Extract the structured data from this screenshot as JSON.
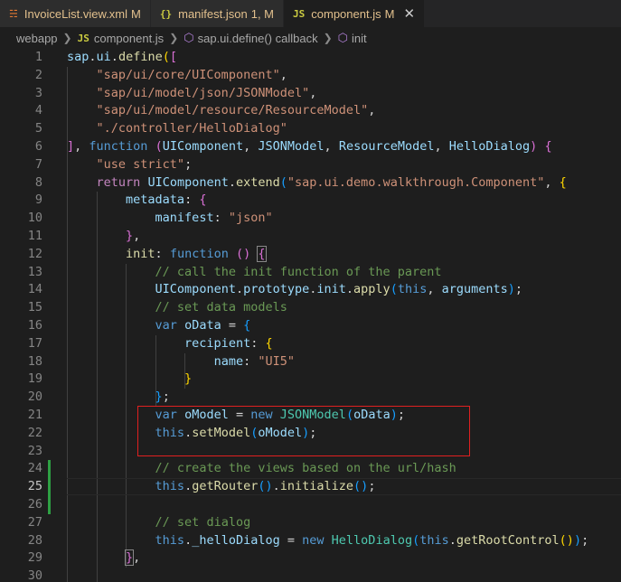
{
  "tabs": [
    {
      "icon": "rss-icon",
      "icon_text": "ॐ",
      "name": "InvoiceList.view.xml",
      "status": "M",
      "active": false
    },
    {
      "icon": "json-icon",
      "icon_text": "{}",
      "name": "manifest.json",
      "status": "1, M",
      "active": false
    },
    {
      "icon": "js-icon",
      "icon_text": "JS",
      "name": "component.js",
      "status": "M",
      "active": true
    }
  ],
  "breadcrumb": {
    "folder": "webapp",
    "file_icon": "JS",
    "file": "component.js",
    "symbol1": "sap.ui.define() callback",
    "symbol2": "init"
  },
  "editor": {
    "active_line": 25,
    "lines": [
      {
        "n": "1",
        "html": "<span class=\"v\">sap</span>.<span class=\"v\">ui</span>.<span class=\"f\">define</span><span class=\"y\">(</span><span class=\"p\">[</span>"
      },
      {
        "n": "2",
        "html": "    <span class=\"s\">\"sap/ui/core/UIComponent\"</span>,"
      },
      {
        "n": "3",
        "html": "    <span class=\"s\">\"sap/ui/model/json/JSONModel\"</span>,"
      },
      {
        "n": "4",
        "html": "    <span class=\"s\">\"sap/ui/model/resource/ResourceModel\"</span>,"
      },
      {
        "n": "5",
        "html": "    <span class=\"s\">\"./controller/HelloDialog\"</span>"
      },
      {
        "n": "6",
        "html": "<span class=\"p\">]</span>, <span class=\"k\">function</span> <span class=\"p\">(</span><span class=\"v\">UIComponent</span>, <span class=\"v\">JSONModel</span>, <span class=\"v\">ResourceModel</span>, <span class=\"v\">HelloDialog</span><span class=\"p\">)</span> <span class=\"p\">{</span>"
      },
      {
        "n": "7",
        "html": "    <span class=\"s\">\"use strict\"</span>;"
      },
      {
        "n": "8",
        "html": "    <span class=\"kc\">return</span> <span class=\"v\">UIComponent</span>.<span class=\"f\">extend</span><span class=\"b\">(</span><span class=\"s\">\"sap.ui.demo.walkthrough.Component\"</span>, <span class=\"y\">{</span>"
      },
      {
        "n": "9",
        "html": "        <span class=\"v\">metadata</span>: <span class=\"p\">{</span>"
      },
      {
        "n": "10",
        "html": "            <span class=\"v\">manifest</span>: <span class=\"s\">\"json\"</span>"
      },
      {
        "n": "11",
        "html": "        <span class=\"p\">}</span>,"
      },
      {
        "n": "12",
        "html": "        <span class=\"f\">init</span>: <span class=\"k\">function</span> <span class=\"p\">()</span> <span class=\"p bracket-box\">{</span>"
      },
      {
        "n": "13",
        "html": "            <span class=\"c\">// call the init function of the parent</span>"
      },
      {
        "n": "14",
        "html": "            <span class=\"v\">UIComponent</span>.<span class=\"v\">prototype</span>.<span class=\"v\">init</span>.<span class=\"f\">apply</span><span class=\"b\">(</span><span class=\"k\">this</span>, <span class=\"v\">arguments</span><span class=\"b\">)</span>;"
      },
      {
        "n": "15",
        "html": "            <span class=\"c\">// set data models</span>"
      },
      {
        "n": "16",
        "html": "            <span class=\"k\">var</span> <span class=\"v\">oData</span> = <span class=\"b\">{</span>"
      },
      {
        "n": "17",
        "html": "                <span class=\"v\">recipient</span>: <span class=\"y\">{</span>"
      },
      {
        "n": "18",
        "html": "                    <span class=\"v\">name</span>: <span class=\"s\">\"UI5\"</span>"
      },
      {
        "n": "19",
        "html": "                <span class=\"y\">}</span>"
      },
      {
        "n": "20",
        "html": "            <span class=\"b\">}</span>;"
      },
      {
        "n": "21",
        "html": "            <span class=\"k\">var</span> <span class=\"v\">oModel</span> = <span class=\"k\">new</span> <span class=\"t\">JSONModel</span><span class=\"b\">(</span><span class=\"v\">oData</span><span class=\"b\">)</span>;"
      },
      {
        "n": "22",
        "html": "            <span class=\"k\">this</span>.<span class=\"f\">setModel</span><span class=\"b\">(</span><span class=\"v\">oModel</span><span class=\"b\">)</span>;"
      },
      {
        "n": "23",
        "html": ""
      },
      {
        "n": "24",
        "html": "            <span class=\"c\">// create the views based on the url/hash</span>"
      },
      {
        "n": "25",
        "html": "            <span class=\"k\">this</span>.<span class=\"f\">getRouter</span><span class=\"b\">()</span>.<span class=\"f\">initialize</span><span class=\"b\">()</span>;"
      },
      {
        "n": "26",
        "html": ""
      },
      {
        "n": "27",
        "html": "            <span class=\"c\">// set dialog</span>"
      },
      {
        "n": "28",
        "html": "            <span class=\"k\">this</span>.<span class=\"v\">_helloDialog</span> = <span class=\"k\">new</span> <span class=\"t\">HelloDialog</span><span class=\"b\">(</span><span class=\"k\">this</span>.<span class=\"f\">getRootControl</span><span class=\"y\">()</span><span class=\"b\">)</span>;"
      },
      {
        "n": "29",
        "html": "        <span class=\"p bracket-box\">}</span>,"
      },
      {
        "n": "30",
        "html": ""
      }
    ]
  }
}
